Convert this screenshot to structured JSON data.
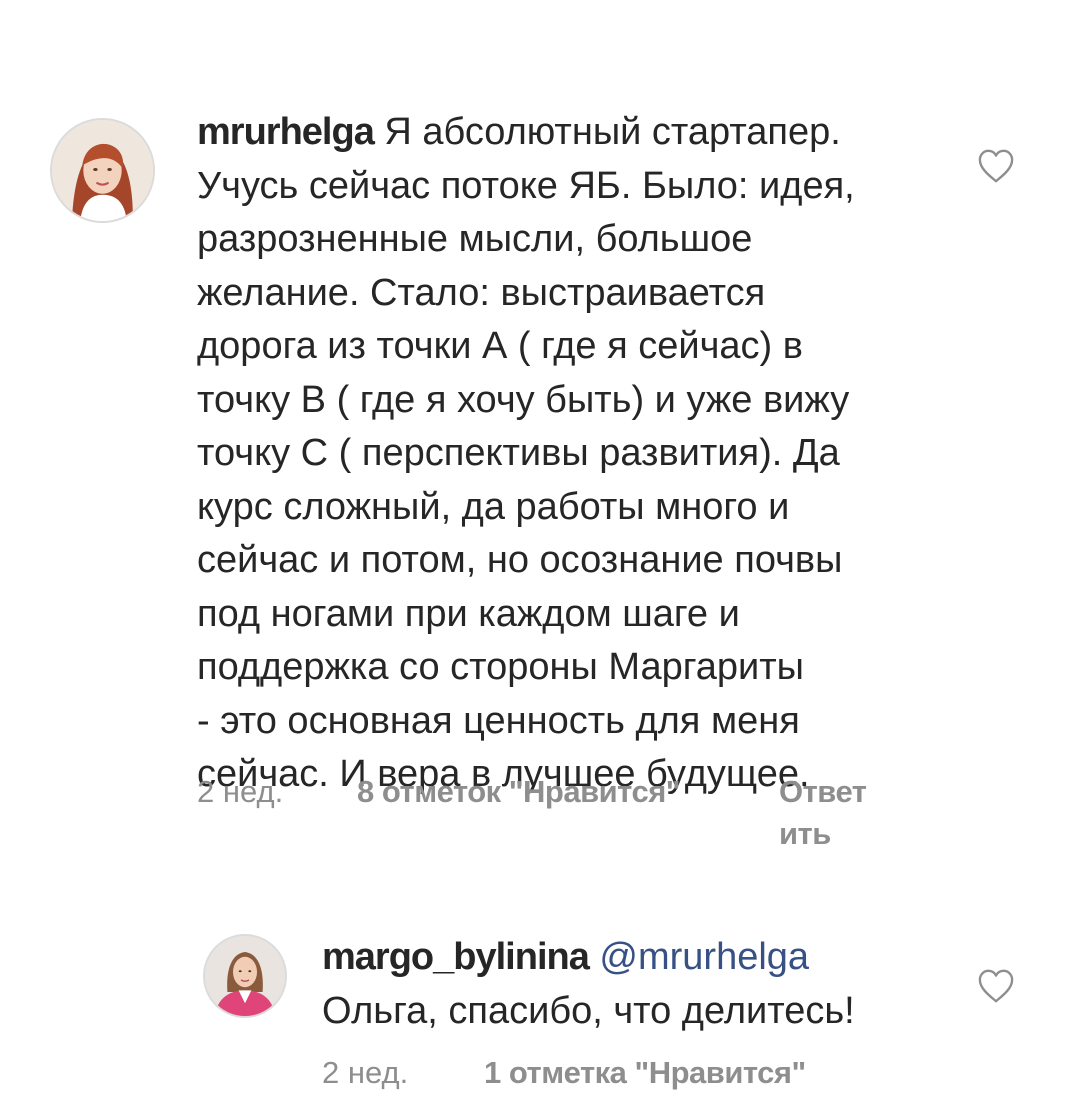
{
  "comments": [
    {
      "username": "mrurhelga",
      "text_lines": [
        "Я абсолютный стартапер.",
        "Учусь сейчас потоке ЯБ. Было: идея,",
        "разрозненные мысли, большое",
        "желание. Стало: выстраивается",
        "дорога из точки А ( где я сейчас) в",
        "точку В ( где я хочу быть) и уже вижу",
        "точку С ( перспективы развития). Да",
        "курс сложный, да работы много и",
        "сейчас и потом, но осознание почвы",
        "под ногами при каждом шаге и",
        "поддержка со стороны Маргариты",
        "- это основная ценность для меня",
        "сейчас. И вера в лучшее будущее."
      ],
      "time": "2 нед.",
      "likes": "8 отметок \"Нравится\"",
      "reply_line1": "Ответ",
      "reply_line2": "ить",
      "avatar_icon": "profile-photo-woman-red-hair",
      "like_icon": "heart-outline-icon"
    },
    {
      "username": "margo_bylinina",
      "mention": "@mrurhelga",
      "text_lines": [
        "Ольга, спасибо, что делитесь!"
      ],
      "time": "2 нед.",
      "likes": "1 отметка \"Нравится\"",
      "avatar_icon": "profile-photo-woman-pink-jacket",
      "like_icon": "heart-outline-icon"
    }
  ],
  "colors": {
    "text": "#262626",
    "meta": "#8e8e8e",
    "mention": "#385185",
    "avatar_border": "#dbdbdb"
  }
}
